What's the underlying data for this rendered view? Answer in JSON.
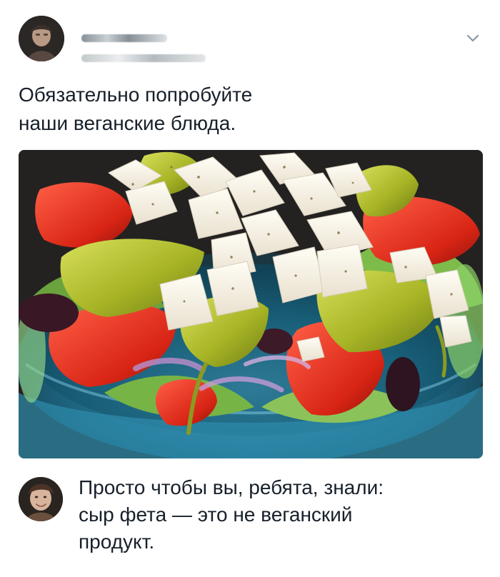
{
  "tweet": {
    "text": "Обязательно попробуйте\nнаши веганские блюда.",
    "menu_icon": "chevron-down-icon"
  },
  "reply": {
    "text": "Просто чтобы вы, ребята, знали:\nсыр фета — это не веганский\nпродукт."
  },
  "colors": {
    "text": "#17202a",
    "chevron": "#8899a6"
  }
}
